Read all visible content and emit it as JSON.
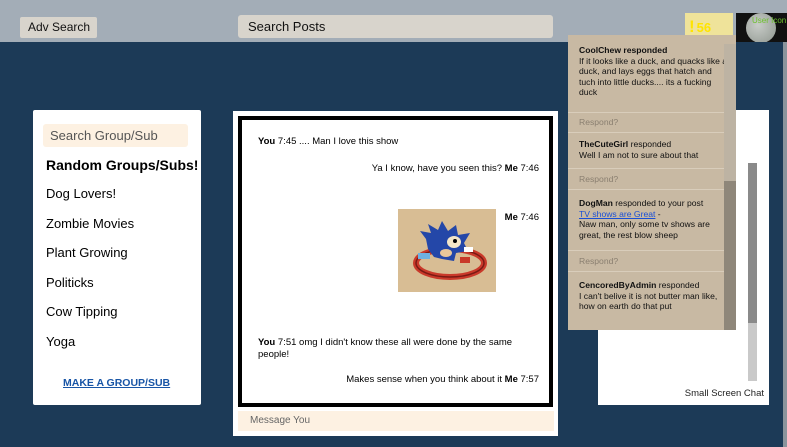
{
  "topbar": {
    "adv_search": "Adv Search",
    "search_posts": "Search Posts",
    "notification_mark": "!",
    "notification_count": "56",
    "avatar_text": "User Icon"
  },
  "sidebar": {
    "search_placeholder": "Search Group/Sub",
    "title": "Random Groups/Subs!",
    "groups": [
      "Dog Lovers!",
      "Zombie Movies",
      "Plant Growing",
      "Politicks",
      "Cow Tipping",
      "Yoga"
    ],
    "make_group": "MAKE A GROUP/SUB"
  },
  "chat": {
    "messages": [
      {
        "sender": "You",
        "time": "7:45",
        "text": ".... Man I love this show"
      },
      {
        "sender": "Me",
        "time": "7:46",
        "text": "Ya I know, have you seen this?"
      },
      {
        "sender": "Me",
        "time": "7:46",
        "text": ""
      },
      {
        "sender": "You",
        "time": "7:51",
        "text": "omg I didn't know these all were done by the same people!"
      },
      {
        "sender": "Me",
        "time": "7:57",
        "text": "Makes sense when you think about it"
      }
    ],
    "input_placeholder": "Message You"
  },
  "small_chat": {
    "label": "Small Screen Chat"
  },
  "notifications": {
    "respond_label": "Respond?",
    "items": [
      {
        "user": "CoolChew",
        "action": "responded",
        "text": "If it looks like a duck, and quacks like a duck, and lays eggs that hatch and tuch into little ducks.... its a fucking duck"
      },
      {
        "user": "TheCuteGirl",
        "action": "responded",
        "text": "Well I am not to sure about that"
      },
      {
        "user": "DogMan",
        "action": "responded to your post",
        "link": "TV shows are Great",
        "text": "Naw man, only some tv shows are great, the rest blow sheep"
      },
      {
        "user": "CencoredByAdmin",
        "action": "responded",
        "text": "I can't belive it is not butter man like, how on earth do that put"
      }
    ]
  },
  "colors": {
    "background": "#1c3a57",
    "topbar": "#a3adb7",
    "dropdown": "#c8b9a3",
    "accent_link": "#1855a6",
    "notification_mark": "#ffe400"
  }
}
